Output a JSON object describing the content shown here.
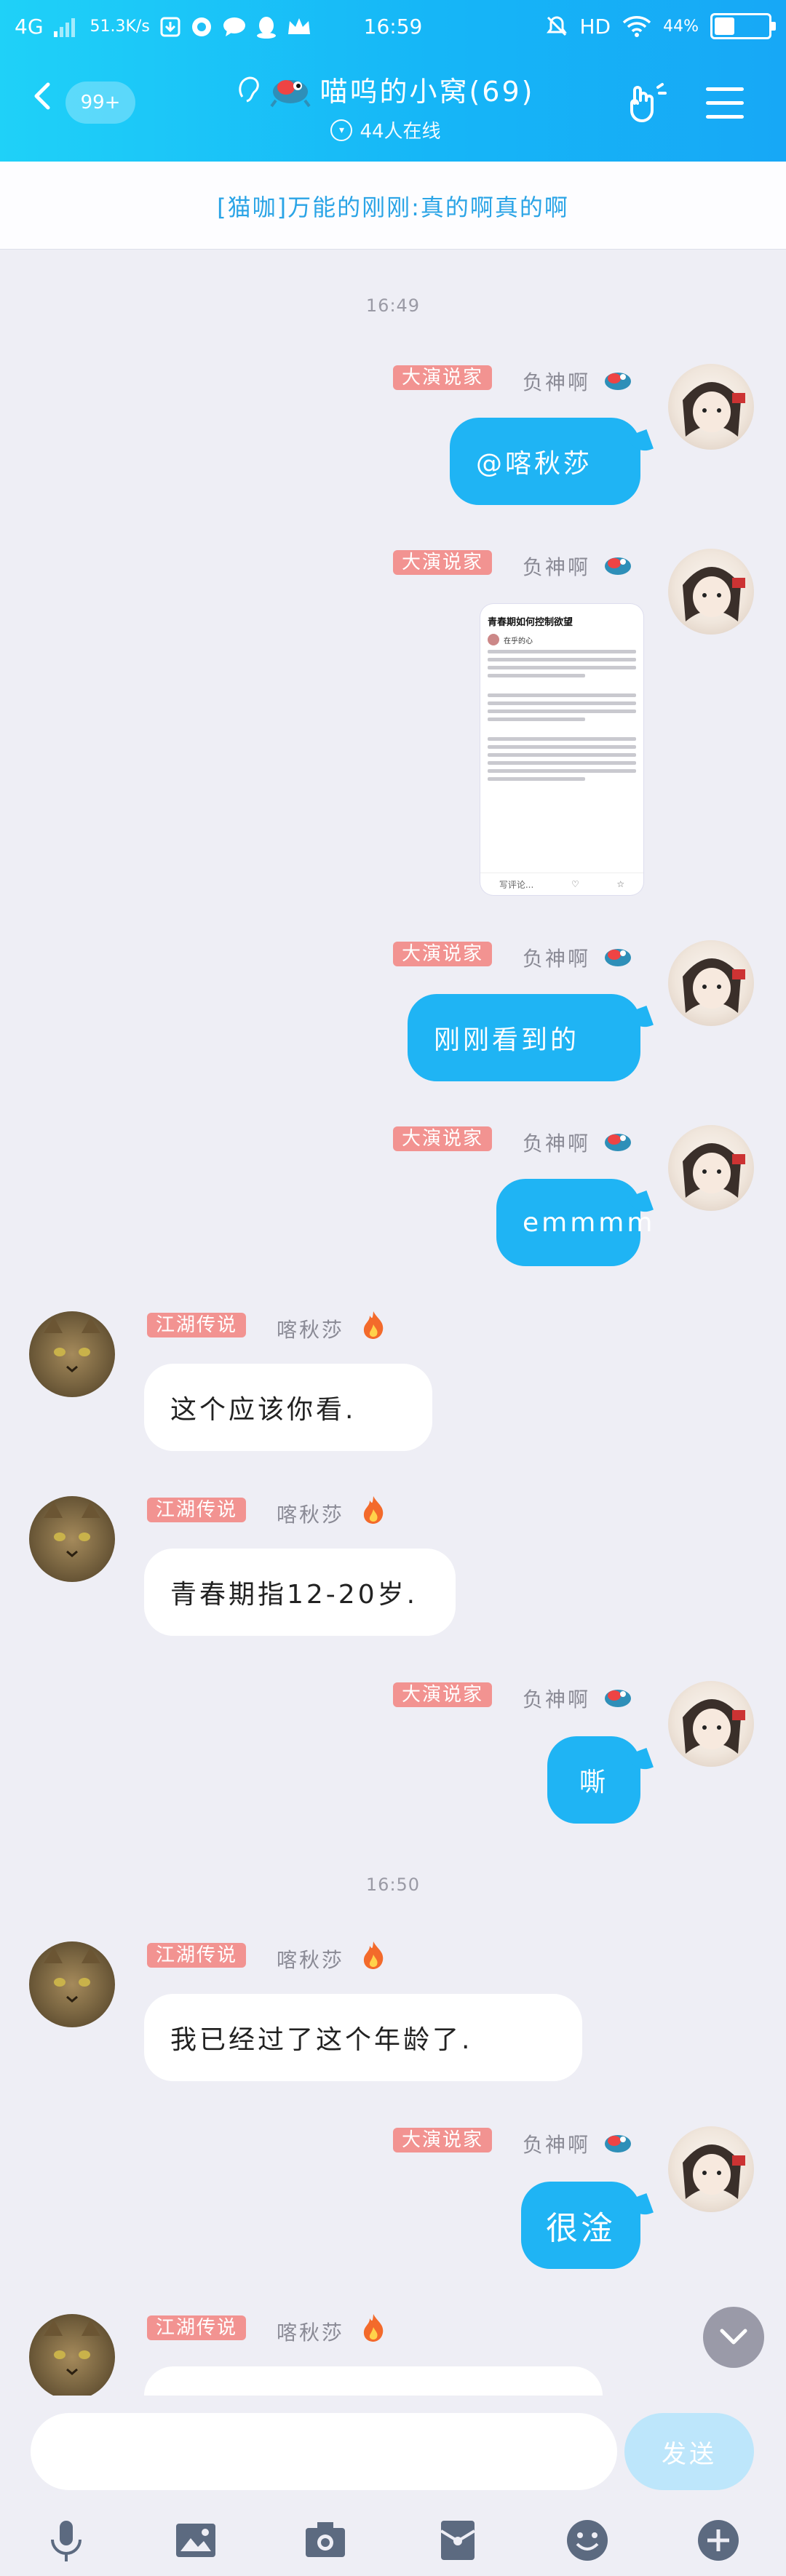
{
  "status_bar": {
    "network": "4G",
    "speed": "51.3K/s",
    "time": "16:59",
    "hd": "HD",
    "battery": "44%"
  },
  "header": {
    "back_badge": "99+",
    "group_title": "喵呜的小窝(69)",
    "online": "44人在线"
  },
  "announcement": "[猫咖]万能的刚刚:真的啊真的啊",
  "colors": {
    "header_start": "#1fd1f8",
    "header_end": "#17a8f6",
    "bubble_me": "#1fb4f4",
    "tag": "#f29391",
    "chat_bg": "#eeeef5"
  },
  "chat": {
    "timestamps": [
      "16:49",
      "16:50"
    ],
    "me": {
      "tag": "大演说家",
      "nick": "负神啊"
    },
    "other": {
      "tag": "江湖传说",
      "nick": "喀秋莎"
    },
    "messages": [
      {
        "side": "me",
        "text": "@喀秋莎"
      },
      {
        "side": "me",
        "type": "image",
        "image": {
          "title": "青春期如何控制欲望",
          "author": "在乎的心",
          "search": "写评论..."
        }
      },
      {
        "side": "me",
        "text": "刚刚看到的"
      },
      {
        "side": "me",
        "text": "emmmm"
      },
      {
        "side": "other",
        "text": "这个应该你看."
      },
      {
        "side": "other",
        "text": "青春期指12-20岁."
      },
      {
        "side": "me",
        "text": "嘶"
      },
      {
        "side": "other",
        "text": "我已经过了这个年龄了."
      },
      {
        "side": "me",
        "text": "很淦"
      },
      {
        "side": "other",
        "text": ""
      }
    ]
  },
  "input": {
    "placeholder": "",
    "send": "发送"
  },
  "toolbar": [
    "mic-icon",
    "image-icon",
    "camera-icon",
    "red-packet-icon",
    "emoji-icon",
    "plus-icon"
  ]
}
